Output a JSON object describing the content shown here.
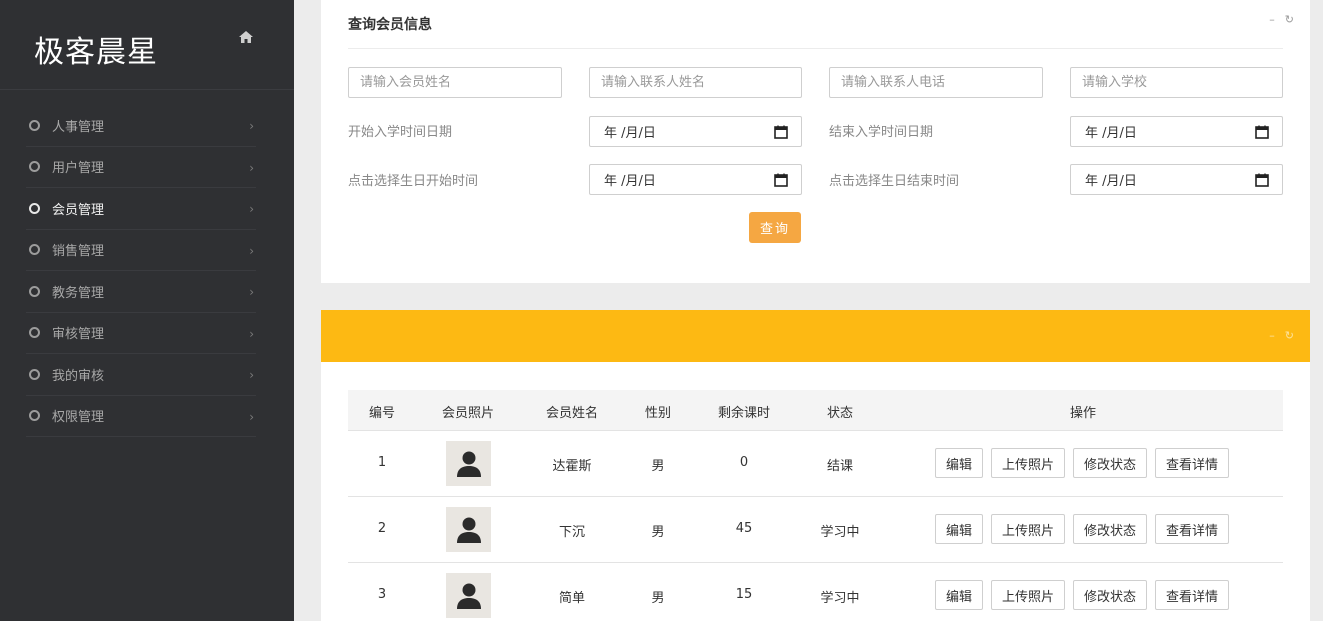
{
  "brand": {
    "logo_text": "极客晨星",
    "home_icon": "home-icon"
  },
  "sidebar": {
    "items": [
      {
        "label": "人事管理",
        "active": false
      },
      {
        "label": "用户管理",
        "active": false
      },
      {
        "label": "会员管理",
        "active": true
      },
      {
        "label": "销售管理",
        "active": false
      },
      {
        "label": "教务管理",
        "active": false
      },
      {
        "label": "审核管理",
        "active": false
      },
      {
        "label": "我的审核",
        "active": false
      },
      {
        "label": "权限管理",
        "active": false
      }
    ]
  },
  "search": {
    "title": "查询会员信息",
    "tools": {
      "collapse": "–",
      "refresh": "↻"
    },
    "placeholders": {
      "member_name": "请输入会员姓名",
      "contact_name": "请输入联系人姓名",
      "contact_phone": "请输入联系人电话",
      "school": "请输入学校"
    },
    "labels": {
      "enroll_start": "开始入学时间日期",
      "enroll_end": "结束入学时间日期",
      "birthday_start": "点击选择生日开始时间",
      "birthday_end": "点击选择生日结束时间"
    },
    "date_placeholder": "年 /月/日",
    "query_button": "查询"
  },
  "list": {
    "tools": {
      "collapse": "–",
      "refresh": "↻"
    },
    "columns": [
      "编号",
      "会员照片",
      "会员姓名",
      "性别",
      "剩余课时",
      "状态",
      "操作"
    ],
    "rows": [
      {
        "id": "1",
        "name": "达霍斯",
        "gender": "男",
        "hours": "0",
        "status": "结课"
      },
      {
        "id": "2",
        "name": "下沉",
        "gender": "男",
        "hours": "45",
        "status": "学习中"
      },
      {
        "id": "3",
        "name": "简单",
        "gender": "男",
        "hours": "15",
        "status": "学习中"
      }
    ],
    "row_actions": {
      "edit": "编辑",
      "upload_photo": "上传照片",
      "change_status": "修改状态",
      "view_detail": "查看详情"
    }
  },
  "colors": {
    "sidebar_bg": "#2f3033",
    "accent_orange": "#f5a742",
    "header_yellow": "#fdb913"
  }
}
